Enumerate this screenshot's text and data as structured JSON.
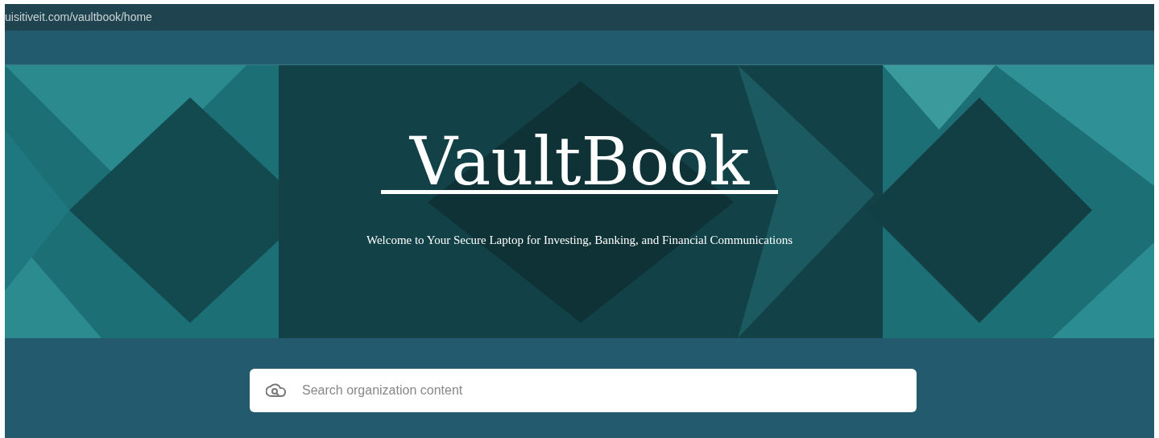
{
  "address_bar": {
    "url": "uisitiveit.com/vaultbook/home"
  },
  "banner": {
    "title": "VaultBook",
    "subtitle": "Welcome to Your Secure Laptop for Investing, Banking, and Financial Communications"
  },
  "search": {
    "placeholder": "Search organization content"
  }
}
